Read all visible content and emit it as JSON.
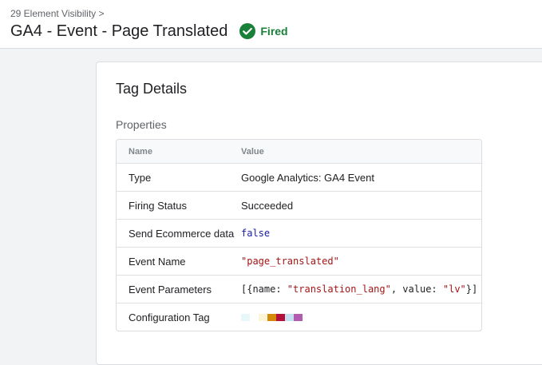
{
  "header": {
    "breadcrumb": "29 Element Visibility >",
    "title": "GA4 - Event - Page Translated",
    "status": {
      "label": "Fired",
      "icon": "check-circle-icon",
      "color": "#188038"
    }
  },
  "card": {
    "title": "Tag Details",
    "section_title": "Properties",
    "table": {
      "columns": [
        "Name",
        "Value"
      ],
      "rows": {
        "type": {
          "name": "Type",
          "value": "Google Analytics: GA4 Event"
        },
        "firing_status": {
          "name": "Firing Status",
          "value": "Succeeded"
        },
        "send_ecommerce": {
          "name": "Send Ecommerce data",
          "value": "false"
        },
        "event_name": {
          "name": "Event Name",
          "value": "\"page_translated\""
        },
        "event_parameters": {
          "name": "Event Parameters",
          "open": "[{name: ",
          "param_name": "\"translation_lang\"",
          "middle": ", value: ",
          "param_value": "\"lv\"",
          "close": "}]"
        },
        "configuration_tag": {
          "name": "Configuration Tag",
          "swatch_colors": [
            "#e8f7fa",
            "#ffffff",
            "#fdf5d8",
            "#d48a08",
            "#b3103c",
            "#c6e0f2",
            "#b25cb0"
          ]
        }
      }
    }
  }
}
